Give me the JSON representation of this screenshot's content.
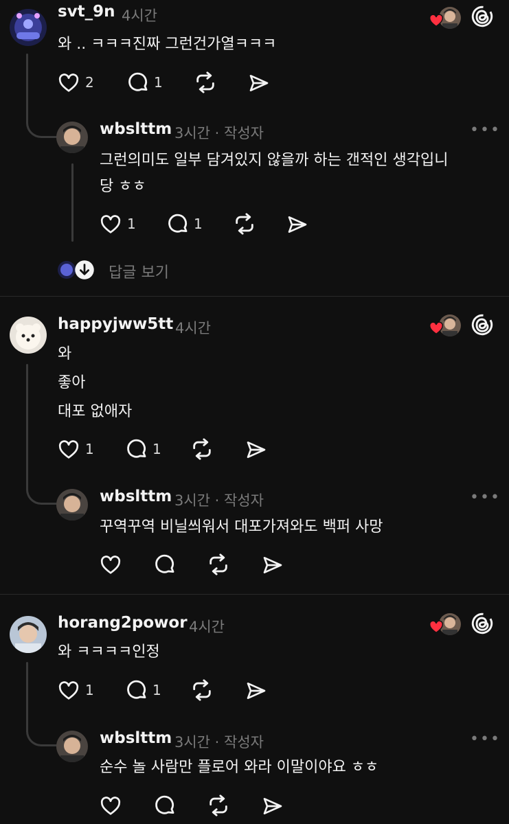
{
  "threads": [
    {
      "username": "svt_9n",
      "time": "4시간",
      "text": "와 .. ㅋㅋㅋ진짜 그런건가열ㅋㅋㅋ",
      "like_count": "2",
      "reply_count": "1",
      "reply": {
        "username": "wbslttm",
        "meta": "3시간 · 작성자",
        "text_lines": [
          "그런의미도 일부 담겨있지 않을까 하는 갠적인 생각입니",
          "당 ㅎㅎ"
        ],
        "like_count": "1",
        "reply_count": "1"
      },
      "view_replies_label": "답글 보기"
    },
    {
      "username": "happyjww5tt",
      "time": "4시간",
      "text_lines": [
        "와",
        "좋아",
        "대포 없애자"
      ],
      "like_count": "1",
      "reply_count": "1",
      "reply": {
        "username": "wbslttm",
        "meta": "3시간 · 작성자",
        "text": "꾸역꾸역 비닐씌워서 대포가져와도 백퍼 사망"
      }
    },
    {
      "username": "horang2powor",
      "time": "4시간",
      "text": "와 ㅋㅋㅋㅋ인정",
      "like_count": "1",
      "reply_count": "1",
      "reply": {
        "username": "wbslttm",
        "meta": "3시간 · 작성자",
        "text": "순수 놀 사람만 플로어 와라 이말이야요 ㅎㅎ"
      }
    }
  ],
  "more_label": "•••",
  "colors": {
    "background": "#101010",
    "text": "#f3f3f3",
    "muted": "#7a7a7a",
    "heart": "#ff3040"
  },
  "icons": [
    "heart-icon",
    "comment-icon",
    "repost-icon",
    "share-icon",
    "threads-logo-icon",
    "more-icon"
  ]
}
